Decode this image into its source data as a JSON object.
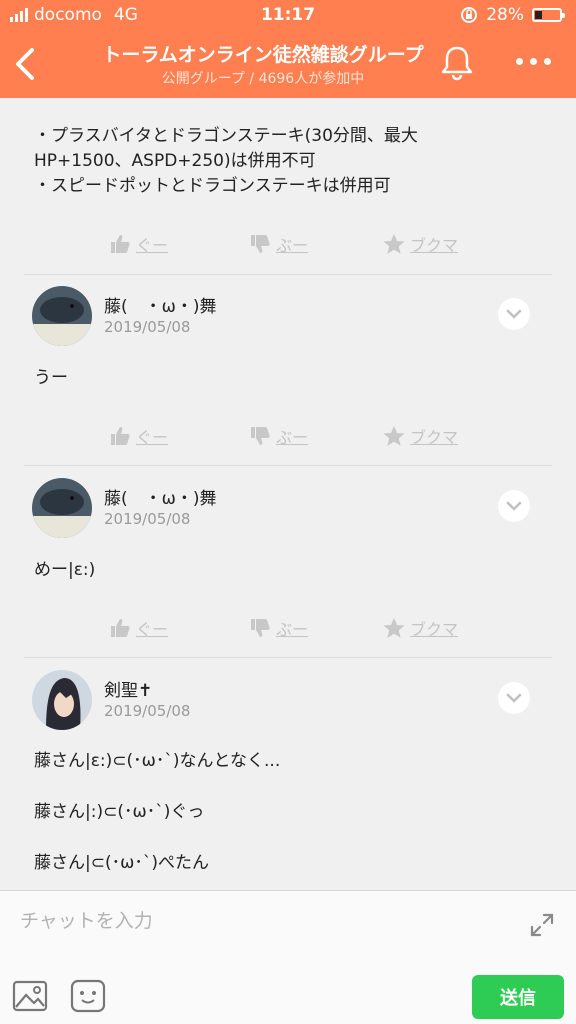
{
  "status_bar": {
    "carrier": "docomo",
    "network": "4G",
    "time": "11:17",
    "battery": "28%"
  },
  "header": {
    "title": "トーラムオンライン徒然雑談グループ",
    "subtitle": "公開グループ / 4696人が参加中"
  },
  "post": {
    "lines": [
      "・プラスバイタとドラゴンステーキ(30分間、最大",
      "HP+1500、ASPD+250)は併用不可",
      "・スピードポットとドラゴンステーキは併用可"
    ]
  },
  "actions": {
    "like": "ぐー",
    "dislike": "ぶー",
    "bookmark": "ブクマ"
  },
  "comments": [
    {
      "author": "藤(　・ω・)舞",
      "date": "2019/05/08",
      "lines": [
        "うー"
      ]
    },
    {
      "author": "藤(　・ω・)舞",
      "date": "2019/05/08",
      "lines": [
        "めー|ε:)"
      ]
    },
    {
      "author": "剣聖✝",
      "date": "2019/05/08",
      "lines": [
        "藤さん|ε:)⊂(･ω･`)なんとなく...",
        "藤さん|:)⊂(･ω･`)ぐっ",
        "藤さん|⊂(･ω･`)ぺたん"
      ]
    }
  ],
  "input": {
    "placeholder": "チャットを入力",
    "send_label": "送信"
  },
  "colors": {
    "header": "#ff7f50",
    "send": "#2ecc54"
  }
}
